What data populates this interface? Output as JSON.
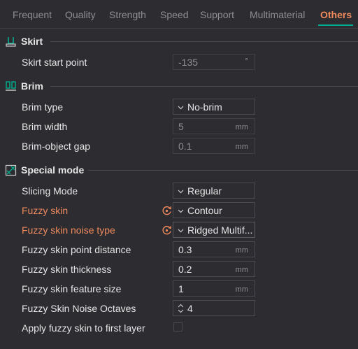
{
  "tabs": [
    {
      "label": "Frequent"
    },
    {
      "label": "Quality"
    },
    {
      "label": "Strength"
    },
    {
      "label": "Speed"
    },
    {
      "label": "Support"
    },
    {
      "label": "Multimaterial"
    },
    {
      "label": "Others"
    }
  ],
  "active_tab": "Others",
  "colors": {
    "accent": "#f08a5d",
    "underline": "#00ae8f",
    "background": "#2d2d31"
  },
  "sections": {
    "skirt": {
      "title": "Skirt",
      "icon": "skirt-icon",
      "skirt_start_point": {
        "label": "Skirt start point",
        "value": "-135",
        "unit": "°"
      }
    },
    "brim": {
      "title": "Brim",
      "icon": "brim-icon",
      "brim_type": {
        "label": "Brim type",
        "value": "No-brim"
      },
      "brim_width": {
        "label": "Brim width",
        "value": "5",
        "unit": "mm"
      },
      "brim_object_gap": {
        "label": "Brim-object gap",
        "value": "0.1",
        "unit": "mm"
      }
    },
    "special": {
      "title": "Special mode",
      "icon": "special-mode-icon",
      "slicing_mode": {
        "label": "Slicing Mode",
        "value": "Regular"
      },
      "fuzzy_skin": {
        "label": "Fuzzy skin",
        "value": "Contour"
      },
      "fuzzy_skin_noise_type": {
        "label": "Fuzzy skin noise type",
        "value": "Ridged Multif..."
      },
      "fuzzy_skin_point_distance": {
        "label": "Fuzzy skin point distance",
        "value": "0.3",
        "unit": "mm"
      },
      "fuzzy_skin_thickness": {
        "label": "Fuzzy skin thickness",
        "value": "0.2",
        "unit": "mm"
      },
      "fuzzy_skin_feature_size": {
        "label": "Fuzzy skin feature size",
        "value": "1",
        "unit": "mm"
      },
      "fuzzy_skin_noise_octaves": {
        "label": "Fuzzy Skin Noise Octaves",
        "value": "4"
      },
      "apply_fuzzy_first_layer": {
        "label": "Apply fuzzy skin to first layer",
        "checked": false
      }
    }
  }
}
